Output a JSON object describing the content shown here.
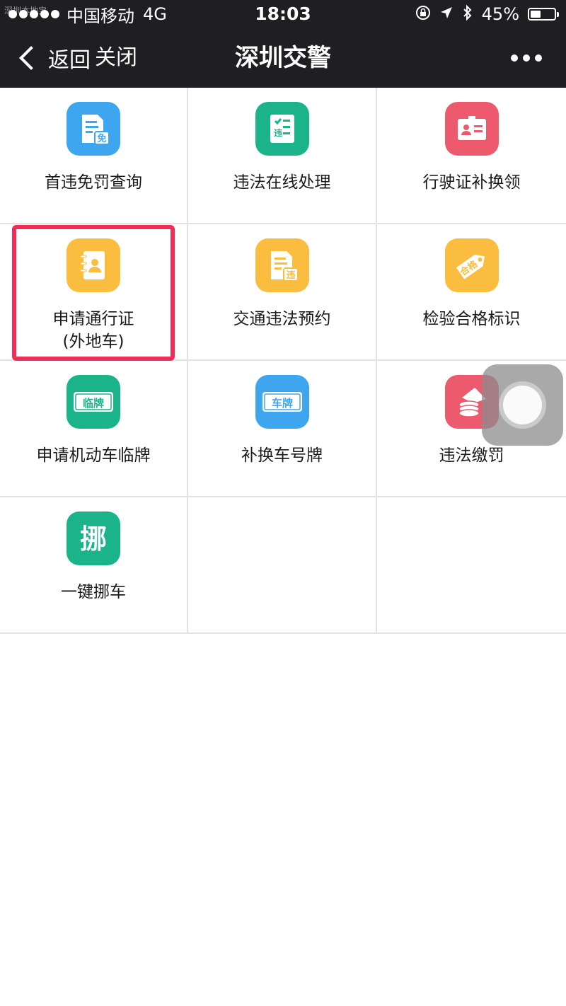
{
  "status_bar": {
    "watermark": "深圳本地宝",
    "carrier": "中国移动",
    "network": "4G",
    "time": "18:03",
    "battery_percent": "45%",
    "battery_level": 0.45
  },
  "nav_bar": {
    "back_label": "返回",
    "close_label": "关闭",
    "title": "深圳交警"
  },
  "grid": {
    "items": [
      {
        "label": "首违免罚查询",
        "icon": "doc-exempt-icon",
        "color": "#3ea6ee",
        "glyph": "免"
      },
      {
        "label": "违法在线处理",
        "icon": "violation-checklist-icon",
        "color": "#1ab38a",
        "glyph": "违"
      },
      {
        "label": "行驶证补换领",
        "icon": "id-card-icon",
        "color": "#ee5a6d"
      },
      {
        "label": "申请通行证",
        "sub": "(外地车)",
        "icon": "address-book-icon",
        "color": "#fbbd3f"
      },
      {
        "label": "交通违法预约",
        "icon": "violation-doc-icon",
        "color": "#fbbd3f",
        "glyph": "违"
      },
      {
        "label": "检验合格标识",
        "icon": "qualified-tag-icon",
        "color": "#fbbd3f",
        "glyph": "合格"
      },
      {
        "label": "申请机动车临牌",
        "icon": "temp-plate-icon",
        "color": "#1ab38a",
        "glyph": "临牌"
      },
      {
        "label": "补换车号牌",
        "icon": "plate-icon",
        "color": "#3ea6ee",
        "glyph": "车牌"
      },
      {
        "label": "违法缴罚",
        "icon": "coins-icon",
        "color": "#ee5a6d"
      },
      {
        "label": "一键挪车",
        "icon": "move-car-icon",
        "color": "#1ab38a",
        "glyph": "挪"
      }
    ]
  },
  "colors": {
    "bar_bg": "#1f1f21",
    "highlight": "#ee2e57",
    "divider": "#e2e2e2"
  }
}
